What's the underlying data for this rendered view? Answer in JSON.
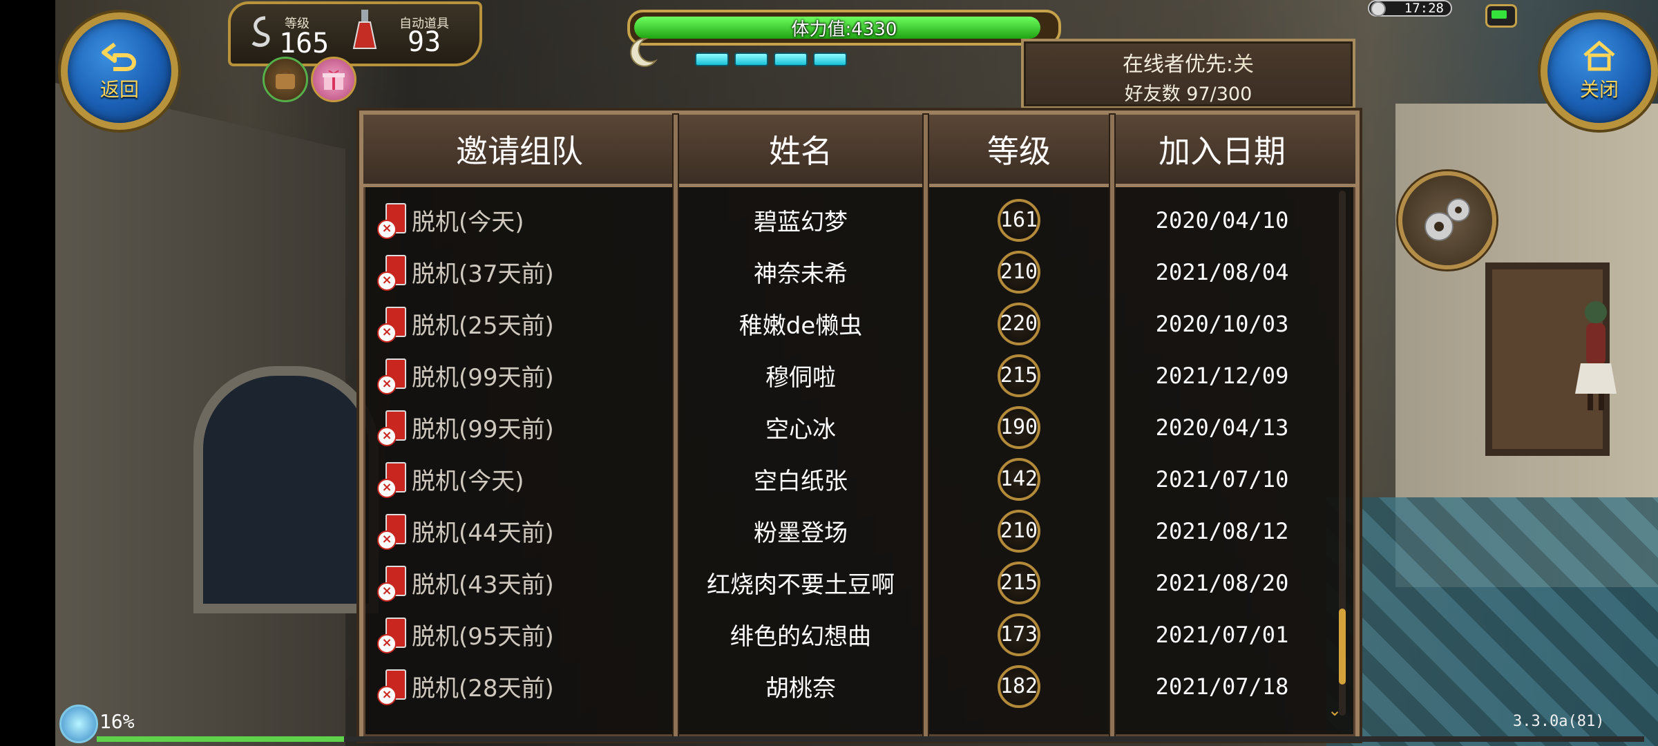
{
  "nav": {
    "back_label": "返回",
    "close_label": "关闭"
  },
  "status": {
    "level_label": "等级",
    "level_value": "165",
    "auto_item_label": "自动道具",
    "auto_item_value": "93"
  },
  "stamina": {
    "text": "体力值:4330",
    "fill_fraction": 0.98,
    "energy_segments": 4
  },
  "clock": {
    "time": "17:28"
  },
  "online": {
    "priority_label": "在线者优先:",
    "priority_value": "关",
    "friend_count_text": "好友数 97/300"
  },
  "table": {
    "headers": [
      "邀请组队",
      "姓名",
      "等级",
      "加入日期"
    ],
    "rows": [
      {
        "status": "脱机(今天)",
        "name": "碧蓝幻梦",
        "level": "161",
        "date": "2020/04/10"
      },
      {
        "status": "脱机(37天前)",
        "name": "神奈未希",
        "level": "210",
        "date": "2021/08/04"
      },
      {
        "status": "脱机(25天前)",
        "name": "稚嫩de懒虫",
        "level": "220",
        "date": "2020/10/03"
      },
      {
        "status": "脱机(99天前)",
        "name": "穆侗啦",
        "level": "215",
        "date": "2021/12/09"
      },
      {
        "status": "脱机(99天前)",
        "name": "空心冰",
        "level": "190",
        "date": "2020/04/13"
      },
      {
        "status": "脱机(今天)",
        "name": "空白纸张",
        "level": "142",
        "date": "2021/07/10"
      },
      {
        "status": "脱机(44天前)",
        "name": "粉墨登场",
        "level": "210",
        "date": "2021/08/12"
      },
      {
        "status": "脱机(43天前)",
        "name": "红烧肉不要土豆啊",
        "level": "215",
        "date": "2021/08/20"
      },
      {
        "status": "脱机(95天前)",
        "name": "绯色的幻想曲",
        "level": "173",
        "date": "2021/07/01"
      },
      {
        "status": "脱机(28天前)",
        "name": "胡桃奈",
        "level": "182",
        "date": "2021/07/18"
      }
    ],
    "scroll_position_fraction": 0.93
  },
  "bottom": {
    "exp_percent_text": "16%",
    "exp_fraction": 0.16,
    "version": "3.3.0a(81)"
  },
  "colors": {
    "gold_border": "#b8933c",
    "stamina_green": "#1fa312",
    "panel_bg": "#12100e",
    "offline_red": "#c8261f"
  }
}
